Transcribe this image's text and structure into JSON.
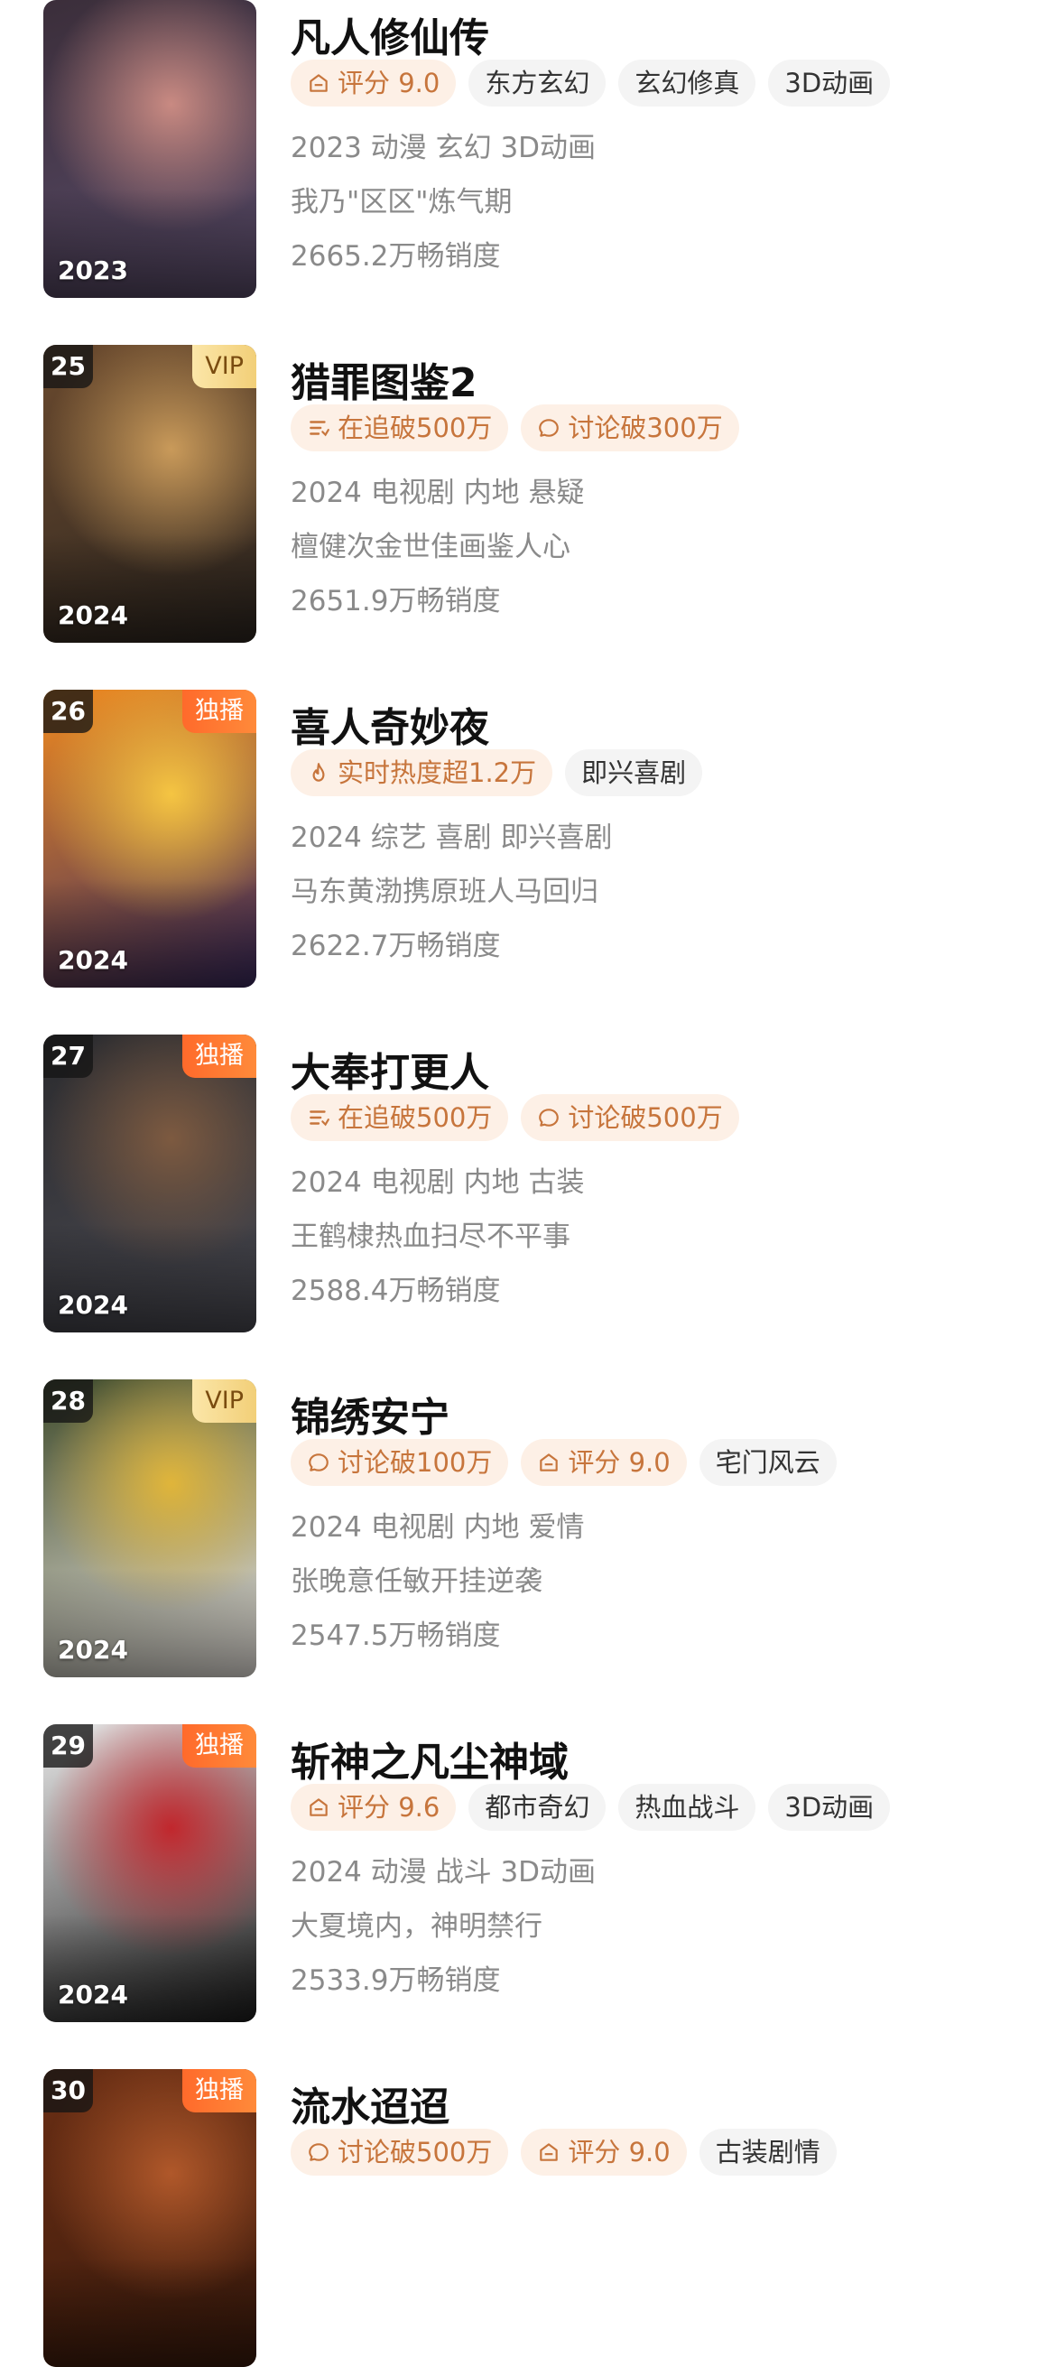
{
  "items": [
    {
      "rank": "",
      "corner": "",
      "corner_type": "",
      "poster_year": "2023",
      "title": "凡人修仙传",
      "tags": [
        {
          "icon": "score-icon",
          "text": "评分 9.0",
          "style": "hot"
        },
        {
          "icon": "",
          "text": "东方玄幻",
          "style": "plain"
        },
        {
          "icon": "",
          "text": "玄幻修真",
          "style": "plain"
        },
        {
          "icon": "",
          "text": "3D动画",
          "style": "plain"
        }
      ],
      "meta": "2023 动漫 玄幻 3D动画",
      "desc": "我乃\"区区\"炼气期",
      "sales": "2665.2万畅销度",
      "poster_colors": [
        "#3b2e3a",
        "#c98a82",
        "#5a4c6a"
      ]
    },
    {
      "rank": "25",
      "corner": "VIP",
      "corner_type": "vip",
      "poster_year": "2024",
      "title": "猎罪图鉴2",
      "tags": [
        {
          "icon": "list-icon",
          "text": "在追破500万",
          "style": "hot"
        },
        {
          "icon": "chat-icon",
          "text": "讨论破300万",
          "style": "hot"
        }
      ],
      "meta": "2024 电视剧 内地 悬疑",
      "desc": "檀健次金世佳画鉴人心",
      "sales": "2651.9万畅销度",
      "poster_colors": [
        "#6b4a2e",
        "#c99a5a",
        "#2d2620"
      ]
    },
    {
      "rank": "26",
      "corner": "独播",
      "corner_type": "excl",
      "poster_year": "2024",
      "title": "喜人奇妙夜",
      "tags": [
        {
          "icon": "flame-icon",
          "text": "实时热度超1.2万",
          "style": "hot"
        },
        {
          "icon": "",
          "text": "即兴喜剧",
          "style": "plain"
        }
      ],
      "meta": "2024 综艺 喜剧 即兴喜剧",
      "desc": "马东黄渤携原班人马回归",
      "sales": "2622.7万畅销度",
      "poster_colors": [
        "#f08a1f",
        "#f5c542",
        "#3a2a60"
      ]
    },
    {
      "rank": "27",
      "corner": "独播",
      "corner_type": "excl",
      "poster_year": "2024",
      "title": "大奉打更人",
      "tags": [
        {
          "icon": "list-icon",
          "text": "在追破500万",
          "style": "hot"
        },
        {
          "icon": "chat-icon",
          "text": "讨论破500万",
          "style": "hot"
        }
      ],
      "meta": "2024 电视剧 内地 古装",
      "desc": "王鹤棣热血扫尽不平事",
      "sales": "2588.4万畅销度",
      "poster_colors": [
        "#2b2b2e",
        "#7d5a40",
        "#4a4a52"
      ]
    },
    {
      "rank": "28",
      "corner": "VIP",
      "corner_type": "vip",
      "poster_year": "2024",
      "title": "锦绣安宁",
      "tags": [
        {
          "icon": "chat-icon",
          "text": "讨论破100万",
          "style": "hot"
        },
        {
          "icon": "score-icon",
          "text": "评分 9.0",
          "style": "hot"
        },
        {
          "icon": "",
          "text": "宅门风云",
          "style": "plain"
        }
      ],
      "meta": "2024 电视剧 内地 爱情",
      "desc": "张晚意任敏开挂逆袭",
      "sales": "2547.5万畅销度",
      "poster_colors": [
        "#3e4a2a",
        "#e0b53a",
        "#f1ece6"
      ]
    },
    {
      "rank": "29",
      "corner": "独播",
      "corner_type": "excl",
      "poster_year": "2024",
      "title": "斩神之凡尘神域",
      "tags": [
        {
          "icon": "score-icon",
          "text": "评分 9.6",
          "style": "hot"
        },
        {
          "icon": "",
          "text": "都市奇幻",
          "style": "plain"
        },
        {
          "icon": "",
          "text": "热血战斗",
          "style": "plain"
        },
        {
          "icon": "",
          "text": "3D动画",
          "style": "plain"
        }
      ],
      "meta": "2024 动漫 战斗 3D动画",
      "desc": "大夏境内，神明禁行",
      "sales": "2533.9万畅销度",
      "poster_colors": [
        "#e9e9e9",
        "#c1272d",
        "#1c1c1c"
      ]
    },
    {
      "rank": "30",
      "corner": "独播",
      "corner_type": "excl",
      "poster_year": "",
      "title": "流水迢迢",
      "tags": [
        {
          "icon": "chat-icon",
          "text": "讨论破500万",
          "style": "hot"
        },
        {
          "icon": "score-icon",
          "text": "评分 9.0",
          "style": "hot"
        },
        {
          "icon": "",
          "text": "古装剧情",
          "style": "plain"
        }
      ],
      "meta": "",
      "desc": "",
      "sales": "",
      "poster_colors": [
        "#6a2e14",
        "#b0582a",
        "#3a1a0c"
      ]
    }
  ]
}
